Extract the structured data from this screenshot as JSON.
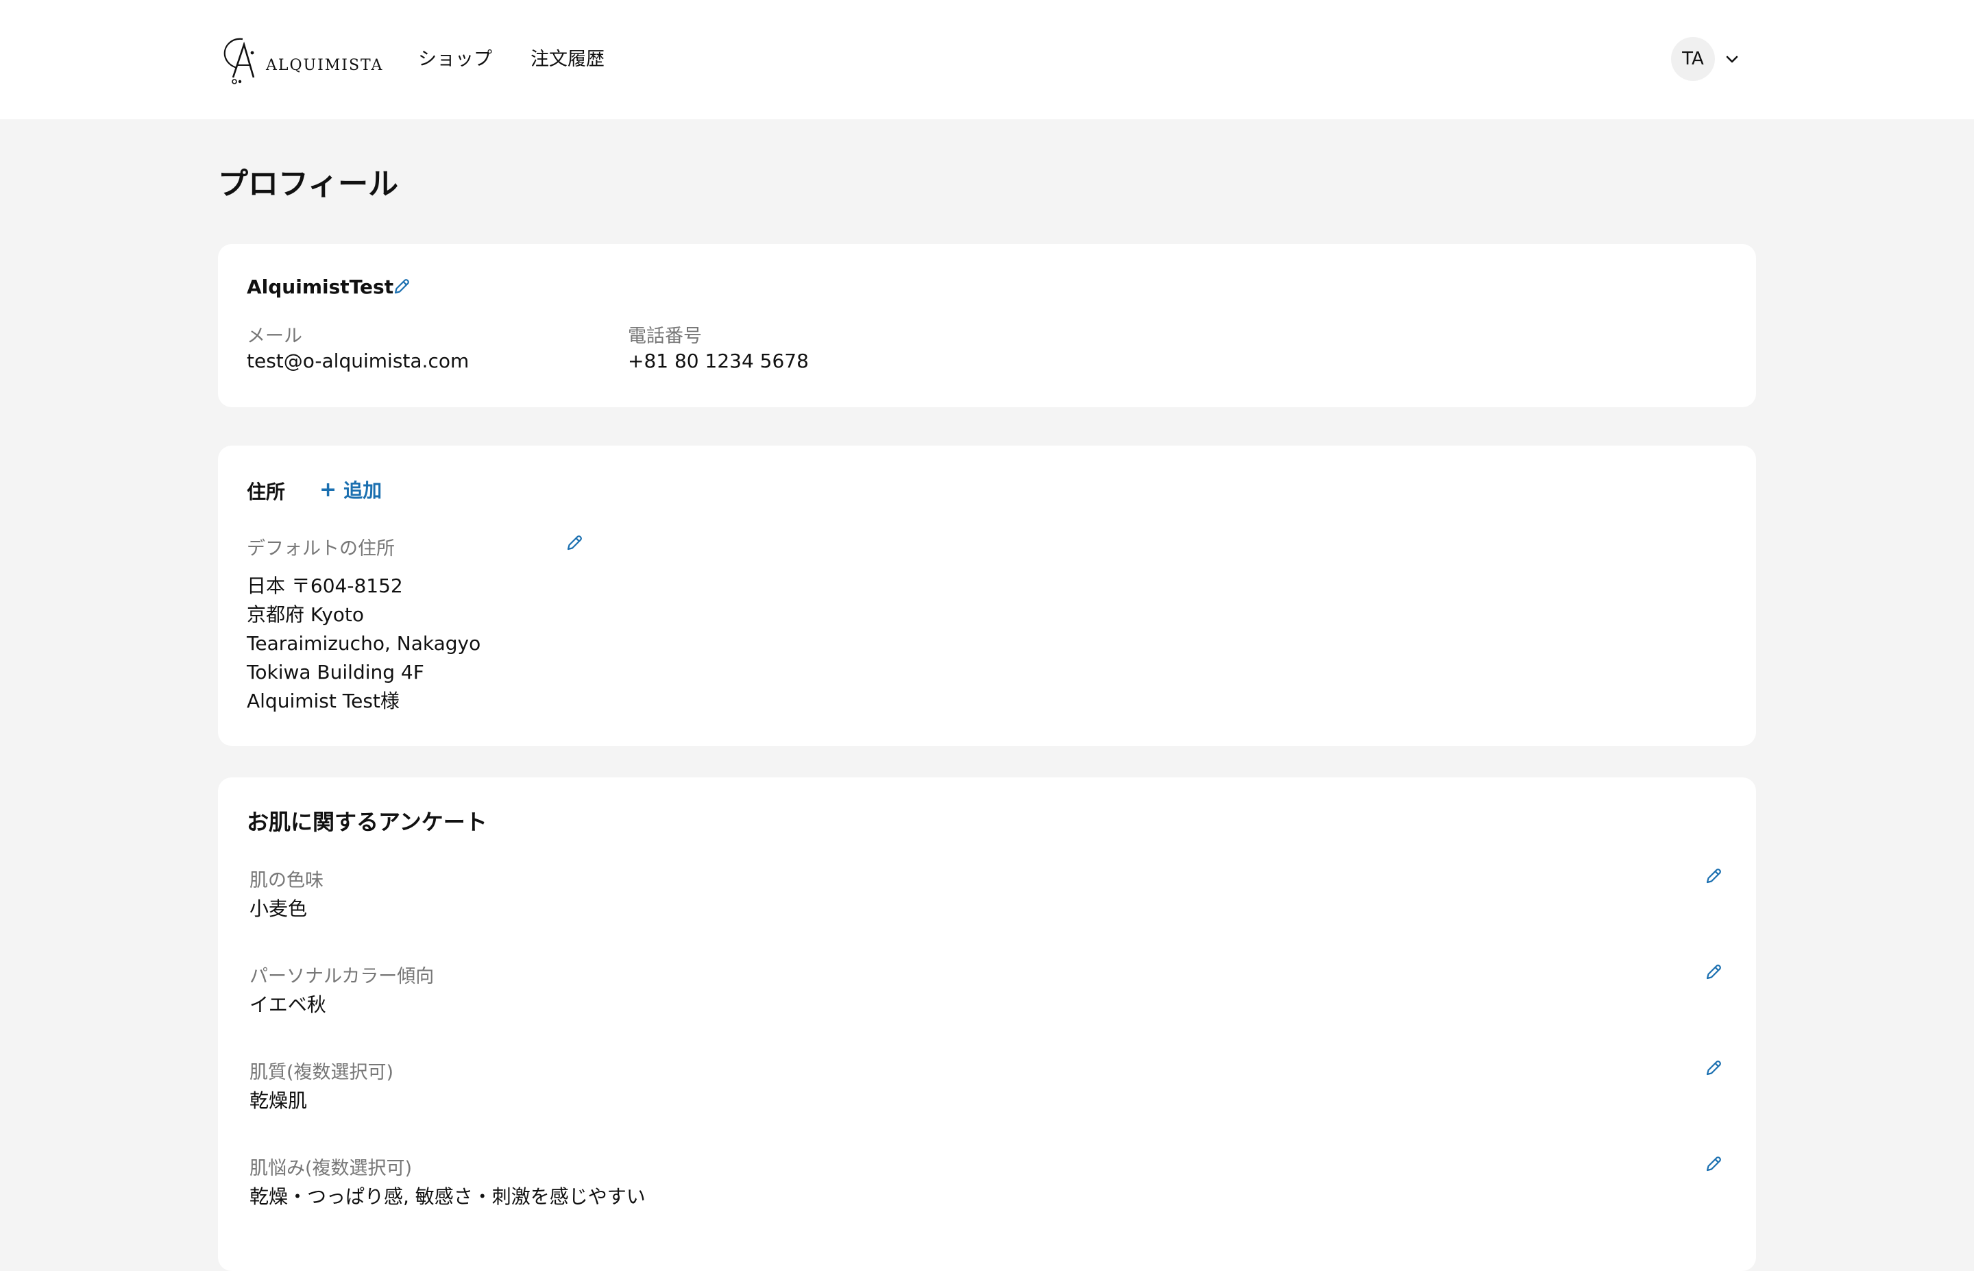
{
  "header": {
    "logo_text": "ALQUIMISTA",
    "nav": [
      {
        "label": "ショップ"
      },
      {
        "label": "注文履歴"
      }
    ],
    "user_initials": "TA"
  },
  "page": {
    "title": "プロフィール"
  },
  "profile": {
    "name": "AlquimistTest",
    "email_label": "メール",
    "email_value": "test@o-alquimista.com",
    "phone_label": "電話番号",
    "phone_value": "+81 80 1234 5678"
  },
  "address": {
    "heading": "住所",
    "add_label": "追加",
    "default_label": "デフォルトの住所",
    "lines": [
      "日本 〒604-8152",
      "京都府 Kyoto",
      "Tearaimizucho, Nakagyo",
      "Tokiwa Building 4F",
      "Alquimist Test様"
    ]
  },
  "survey": {
    "heading": "お肌に関するアンケート",
    "items": [
      {
        "label": "肌の色味",
        "value": "小麦色"
      },
      {
        "label": "パーソナルカラー傾向",
        "value": "イエベ秋"
      },
      {
        "label": "肌質(複数選択可)",
        "value": "乾燥肌"
      },
      {
        "label": "肌悩み(複数選択可)",
        "value": "乾燥・つっぱり感, 敏感さ・刺激を感じやすい"
      }
    ]
  },
  "colors": {
    "accent": "#1a6fb0",
    "background": "#f4f4f4",
    "card": "#ffffff",
    "muted_text": "#777777"
  },
  "icons": {
    "edit": "pencil-icon",
    "add": "plus-icon",
    "menu": "chevron-down-icon",
    "logo": "alquimista-logo"
  }
}
